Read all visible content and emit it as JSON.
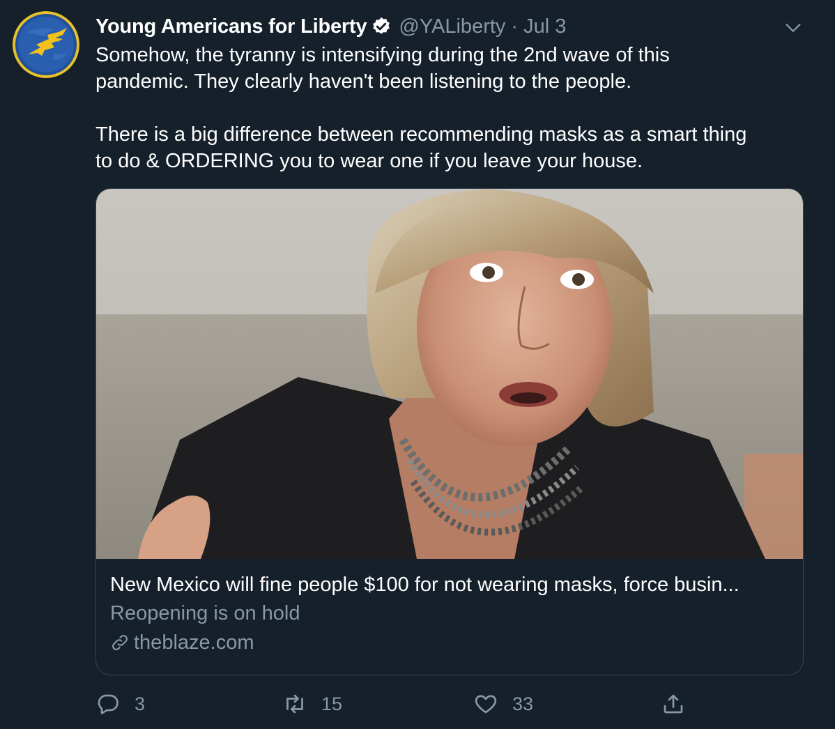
{
  "tweet": {
    "display_name": "Young Americans for Liberty",
    "handle": "@YALiberty",
    "separator": "·",
    "timestamp": "Jul 3",
    "paragraphs": [
      "Somehow, the tyranny is intensifying during the 2nd wave of this\npandemic. They clearly haven't been listening to the people.",
      "There is a big difference between recommending masks as a smart thing\nto do & ORDERING you to wear one if you leave your house."
    ]
  },
  "card": {
    "title": "New Mexico will fine people $100 for not wearing masks, force busin...",
    "description": "Reopening is on hold",
    "domain": "theblaze.com"
  },
  "actions": {
    "replies": "3",
    "retweets": "15",
    "likes": "33"
  },
  "icons": {
    "avatar": "yal-eagle-logo",
    "verified": "verified-badge-icon",
    "menu": "chevron-down-icon",
    "link": "link-icon",
    "reply": "reply-icon",
    "retweet": "retweet-icon",
    "like": "heart-icon",
    "share": "share-icon"
  },
  "colors": {
    "background": "#15202b",
    "secondary_text": "#8899a6",
    "border": "#38444d",
    "logo_blue": "#1f4f9a",
    "logo_gold": "#f2c21b"
  }
}
